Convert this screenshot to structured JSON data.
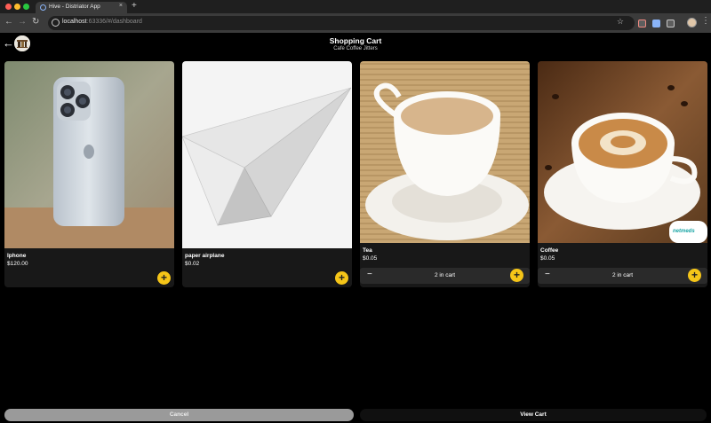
{
  "browser": {
    "tab_title": "Hive - Distriator App",
    "tab_close": "×",
    "new_tab": "+",
    "url_host": "localhost",
    "url_rest": ":63336/#/dashboard",
    "nav_back": "←",
    "nav_forward": "→",
    "nav_reload": "↻",
    "star": "☆",
    "menu": "⋮"
  },
  "header": {
    "back": "←",
    "title": "Shopping Cart",
    "subtitle": "Cafe Coffee Jitters"
  },
  "products": [
    {
      "name": "Iphone",
      "price": "$120.00",
      "add_label": "+"
    },
    {
      "name": "paper airplane",
      "price": "$0.02",
      "add_label": "+"
    },
    {
      "name": "Tea",
      "price": "$0.05",
      "minus_label": "−",
      "in_cart": "2 in cart",
      "plus_label": "+"
    },
    {
      "name": "Coffee",
      "price": "$0.05",
      "minus_label": "−",
      "in_cart": "2 in cart",
      "plus_label": "+",
      "badge_text": "netmeds"
    }
  ],
  "footer": {
    "cancel_label": "Cancel",
    "view_cart_label": "View Cart"
  },
  "colors": {
    "accent": "#f5c518",
    "background": "#000000",
    "card": "#181818"
  }
}
